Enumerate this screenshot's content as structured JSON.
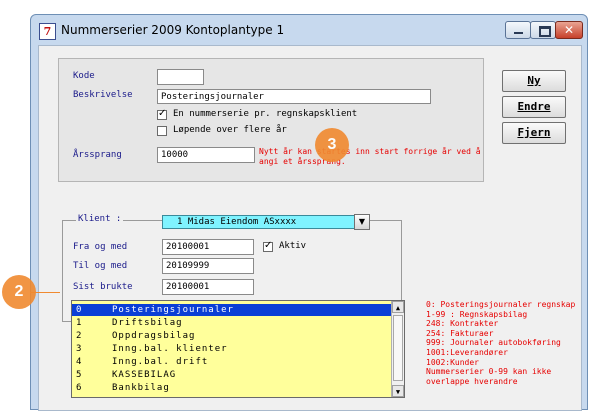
{
  "window": {
    "title": "Nummerserier 2009 Kontoplantype 1",
    "icon_glyph": "7",
    "controls": {
      "minimize": "minimize-icon",
      "maximize": "maximize-icon",
      "close": "close-icon",
      "close_glyph": "✕"
    }
  },
  "form": {
    "kode_label": "Kode",
    "kode_value": "",
    "beskrivelse_label": "Beskrivelse",
    "beskrivelse_value": "Posteringsjournaler",
    "checkbox1_label": "En nummerserie pr. regnskapsklient",
    "checkbox1_checked": true,
    "checkbox2_label": "Løpende over flere år",
    "checkbox2_checked": false,
    "arssprang_label": "Årssprang",
    "arssprang_value": "10000",
    "note": "Nytt år kan startes inn start forrige år ved å angi et årssprang."
  },
  "buttons": {
    "ny": "Ny",
    "endre": "Endre",
    "fjern": "Fjern"
  },
  "klient": {
    "label": "Klient :",
    "selected": "1  Midas Eiendom ASxxxx",
    "fra_og_med_label": "Fra og med",
    "fra_og_med_value": "20100001",
    "aktiv_label": "Aktiv",
    "aktiv_checked": true,
    "til_og_med_label": "Til og med",
    "til_og_med_value": "20109999",
    "sist_brukte_label": "Sist brukte",
    "sist_brukte_value": "20100001"
  },
  "list": {
    "rows": [
      {
        "no": "0",
        "name": "Posteringsjournaler",
        "selected": true
      },
      {
        "no": "1",
        "name": "Driftsbilag"
      },
      {
        "no": "2",
        "name": "Oppdragsbilag"
      },
      {
        "no": "3",
        "name": "Inng.bal. klienter"
      },
      {
        "no": "4",
        "name": "Inng.bal. drift"
      },
      {
        "no": "5",
        "name": "KASSEBILAG"
      },
      {
        "no": "6",
        "name": "Bankbilag"
      }
    ]
  },
  "info_lines": [
    "0: Posteringsjournaler regnskap",
    "1-99 : Regnskapsbilag",
    "248: Kontrakter",
    "254: Fakturaer",
    "999: Journaler autobokføring",
    "1001:Leverandører",
    "1002:Kunder",
    "Nummerserier 0-99 kan ikke",
    "overlappe hverandre"
  ],
  "callouts": {
    "two": "2",
    "three": "3"
  },
  "colors": {
    "list_bg": "#ffff9b",
    "selection": "#0b3fd6",
    "combo_bg": "#7ff3ff",
    "note_red": "#e60000",
    "callout": "#f08a30"
  }
}
